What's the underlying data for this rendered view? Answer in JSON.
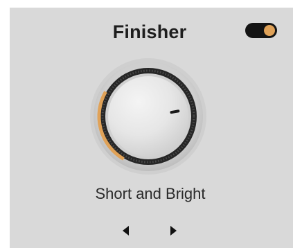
{
  "plugin": {
    "title": "Finisher",
    "enabled": true,
    "accent_color": "#e0a258",
    "knob": {
      "value": 0.3
    },
    "preset": {
      "name": "Short and Bright"
    },
    "nav": {
      "prev_icon": "triangle-left-icon",
      "next_icon": "triangle-right-icon"
    }
  }
}
